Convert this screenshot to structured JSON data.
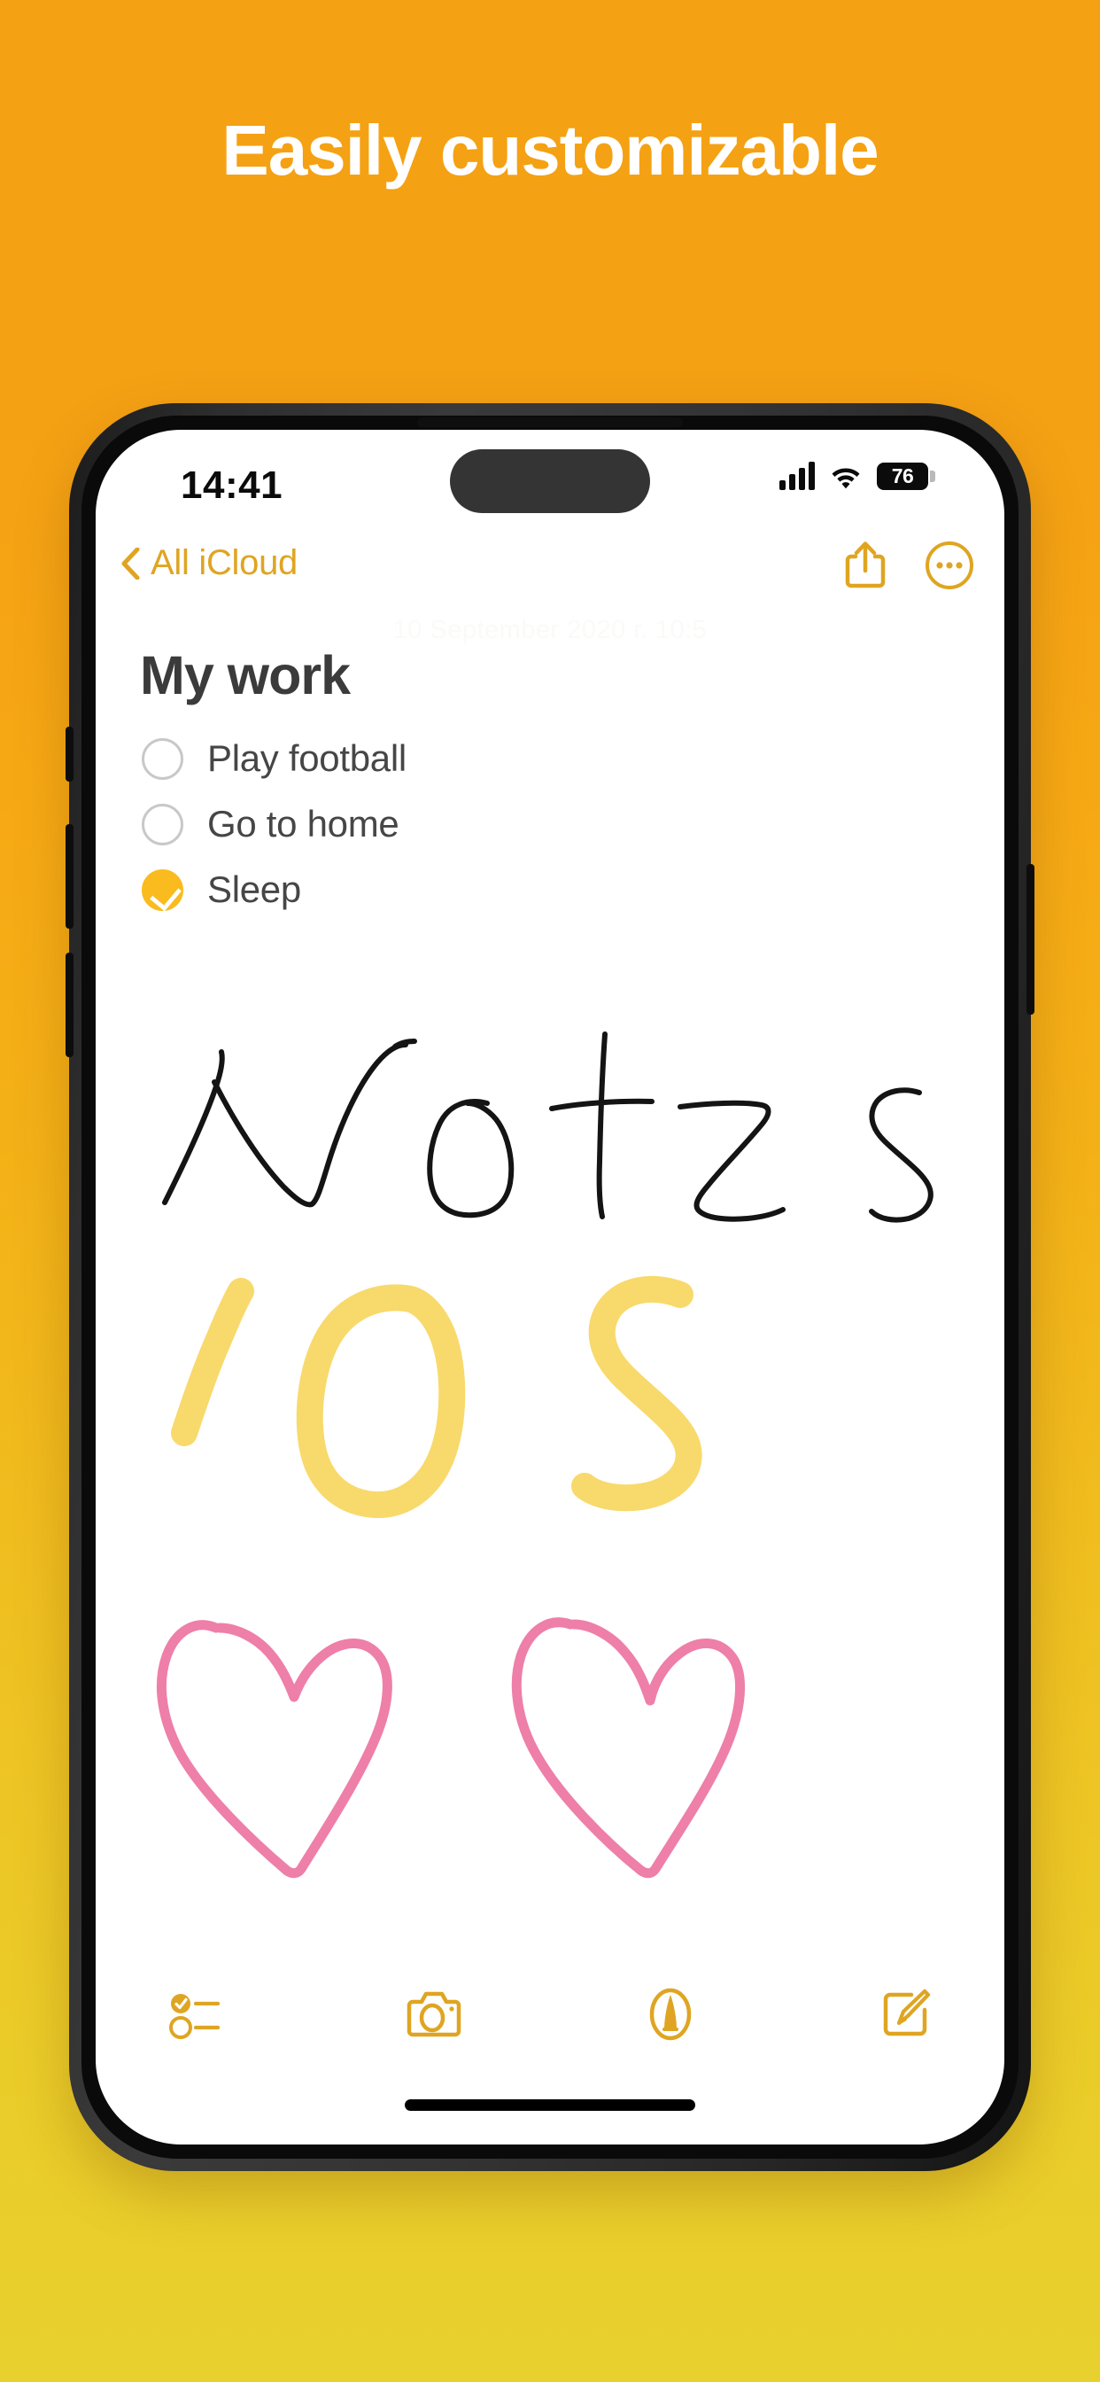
{
  "promo": {
    "headline": "Easily customizable",
    "background_top_color": "#F5A114",
    "background_bottom_color": "#E8D02E",
    "headline_color": "#FFFFFF"
  },
  "device": {
    "frame_color": "#2E2E2E",
    "screen_color": "#FFFFFF"
  },
  "status_bar": {
    "time": "14:41",
    "signal_icon": "cellular-bars-icon",
    "wifi_icon": "wifi-icon",
    "battery_level": "76",
    "battery_icon": "battery-icon"
  },
  "nav_bar": {
    "back_icon": "chevron-left-icon",
    "back_label": "All iCloud",
    "share_icon": "share-icon",
    "more_icon": "more-circle-icon",
    "accent_color": "#DFA522"
  },
  "note": {
    "ghost_date": "10 September 2020 г. 10:5",
    "title": "My work",
    "checklist": [
      {
        "label": "Play football",
        "done": false
      },
      {
        "label": "Go to home",
        "done": false
      },
      {
        "label": "Sleep",
        "done": true
      }
    ],
    "drawings": [
      {
        "name": "handwritten-notes-text",
        "text": "Notes",
        "color": "#141414",
        "stroke": 6
      },
      {
        "name": "handwritten-ios-text",
        "text": "iOS",
        "color": "#F8D96B",
        "stroke": 30
      },
      {
        "name": "handwritten-heart-left",
        "text": "heart",
        "color": "#EE7FA8",
        "stroke": 11
      },
      {
        "name": "handwritten-heart-right",
        "text": "heart",
        "color": "#EE7FA8",
        "stroke": 11
      }
    ],
    "checkbox_done_color": "#FABB1E",
    "title_color": "#3B3B3B"
  },
  "toolbar": {
    "accent_color": "#DFA522",
    "items": [
      {
        "name": "checklist-icon",
        "label": "Checklist"
      },
      {
        "name": "camera-icon",
        "label": "Camera"
      },
      {
        "name": "markup-pen-icon",
        "label": "Markup"
      },
      {
        "name": "compose-icon",
        "label": "Compose"
      }
    ]
  }
}
